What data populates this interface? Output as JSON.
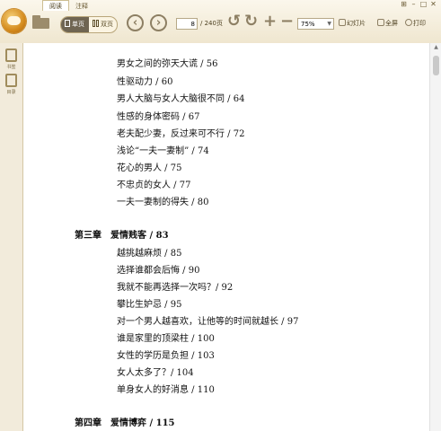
{
  "tabs": [
    "阅读",
    "注释"
  ],
  "toolbar": {
    "single_page": "单页",
    "double_page": "双页",
    "current_page": "8",
    "total_pages": "/ 240页",
    "zoom": "75%",
    "slideshow": "幻灯片",
    "fullscreen": "全屏",
    "print": "打印"
  },
  "sidebar": [
    {
      "label": "书签",
      "icon": "bookmark-icon"
    },
    {
      "label": "目录",
      "icon": "toc-icon"
    }
  ],
  "toc_block1": [
    "男女之间的弥天大谎 / 56",
    "性驱动力 / 60",
    "男人大脑与女人大脑很不同 / 64",
    "性感的身体密码 / 67",
    "老夫配少妻，反过来可不行 / 72",
    "浅论“一夫一妻制” / 74",
    "花心的男人 / 75",
    "不忠贞的女人 / 77",
    "一夫一妻制的得失 / 80"
  ],
  "chapter3": "第三章　爱情贱客 / 83",
  "toc_block2": [
    "越挑越麻烦 / 85",
    "选择谁都会后悔 / 90",
    "我就不能再选择一次吗？/ 92",
    "攀比生妒忌 / 95",
    "对一个男人越喜欢，让他等的时间就越长 / 97",
    "谁是家里的顶梁柱 / 100",
    "女性的学历是负担 / 103",
    "女人太多了？/ 104",
    "单身女人的好消息 / 110"
  ],
  "chapter4": "第四章　爱情博弈 / 115"
}
